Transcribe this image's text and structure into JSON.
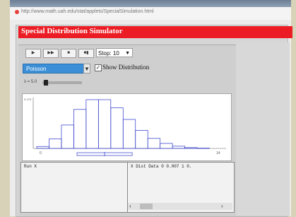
{
  "browser": {
    "url": "http://www.math.uah.edu/stat/applets/SpecialSimulation.html"
  },
  "app": {
    "title": "Special Distribution Simulator"
  },
  "toolbar": {
    "buttons": [
      {
        "name": "step-button",
        "glyph": "▶"
      },
      {
        "name": "run-button",
        "glyph": "▶▶"
      },
      {
        "name": "stop-button",
        "glyph": "■"
      },
      {
        "name": "reset-button",
        "glyph": "■▮"
      }
    ],
    "stop_select_value": "Stop: 10"
  },
  "distribution": {
    "selected": "Poisson",
    "show_distribution_label": "Show Distribution",
    "show_distribution_checked": true
  },
  "parameter": {
    "label": "λ = 5.0",
    "value": 5.0,
    "slider_fraction": 0.1
  },
  "chart_data": {
    "type": "bar",
    "x": [
      0,
      1,
      2,
      3,
      4,
      5,
      6,
      7,
      8,
      9,
      10,
      11,
      12,
      13,
      14
    ],
    "values": [
      0.007,
      0.034,
      0.084,
      0.14,
      0.175,
      0.175,
      0.146,
      0.104,
      0.065,
      0.036,
      0.018,
      0.008,
      0.003,
      0.001,
      0.0
    ],
    "ylim": [
      0,
      0.175
    ],
    "y_tick_label": "0.175",
    "x_tick_labels": [
      "0",
      "14"
    ],
    "colors": {
      "bars": "#2b35c8"
    },
    "mean_sd_bar": {
      "mean": 5.0,
      "sd": 2.236
    }
  },
  "tables": {
    "left_header": "Run    X",
    "right_header": "X      Dist    Data 0   0.007 1 0."
  },
  "colors": {
    "title_bar": "#ec1c24",
    "select_blue": "#3c8fd6"
  }
}
